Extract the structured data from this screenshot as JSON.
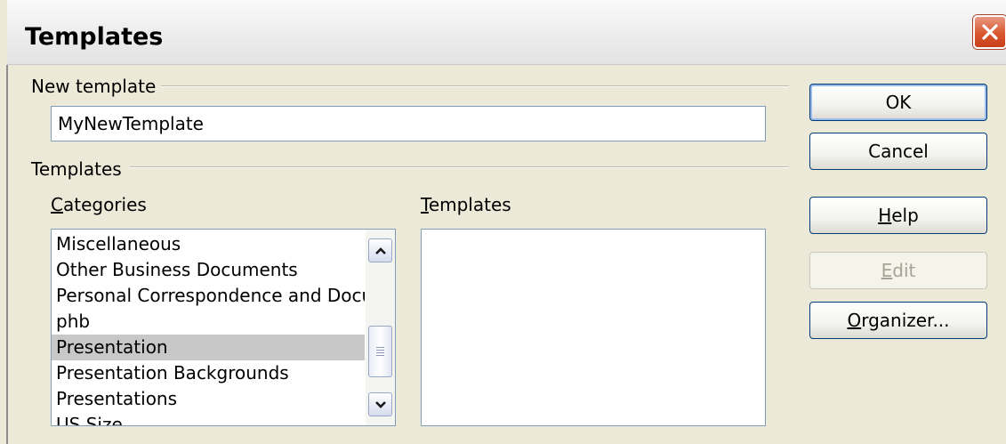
{
  "window": {
    "title": "Templates",
    "close_icon": "close-icon"
  },
  "new_template": {
    "group_label": "New template",
    "name_value": "MyNewTemplate"
  },
  "templates_group": {
    "group_label": "Templates",
    "categories_label_prefix": "",
    "categories_label_accel": "C",
    "categories_label_rest": "ategories",
    "templates_label_accel": "T",
    "templates_label_rest": "emplates",
    "categories": [
      {
        "label": "Miscellaneous"
      },
      {
        "label": "Other Business Documents"
      },
      {
        "label": "Personal Correspondence and Docu"
      },
      {
        "label": "phb"
      },
      {
        "label": "Presentation",
        "selected": true
      },
      {
        "label": "Presentation Backgrounds"
      },
      {
        "label": "Presentations"
      },
      {
        "label": "US Size"
      }
    ],
    "templates": []
  },
  "buttons": {
    "ok": "OK",
    "cancel": "Cancel",
    "help_accel": "H",
    "help_rest": "elp",
    "edit_accel": "E",
    "edit_rest": "dit",
    "organizer_accel": "O",
    "organizer_rest": "rganizer..."
  },
  "colors": {
    "selection": "#c8c8c8",
    "close_button": "#d9572f",
    "dialog_bg": "#ece9d8"
  }
}
